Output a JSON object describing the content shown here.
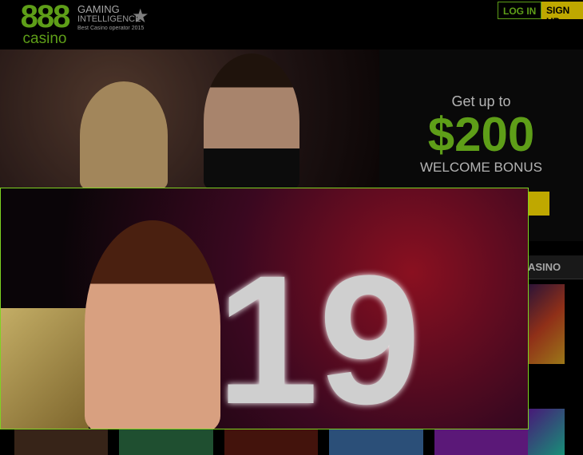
{
  "header": {
    "logo_number": "888",
    "logo_word": "casino",
    "award_line1": "GAMING",
    "award_line2": "INTELLIGENCE",
    "award_line3": "Best Casino operator 2015",
    "login": "LOG IN",
    "signup": "SIGN UP"
  },
  "promo": {
    "intro": "Get up to",
    "amount": "$200",
    "bonus": "WELCOME BONUS"
  },
  "section": {
    "title": "ASINO"
  },
  "popup": {
    "number": "19"
  },
  "colors": {
    "brand": "#7ed321",
    "signup": "#ffe000"
  }
}
